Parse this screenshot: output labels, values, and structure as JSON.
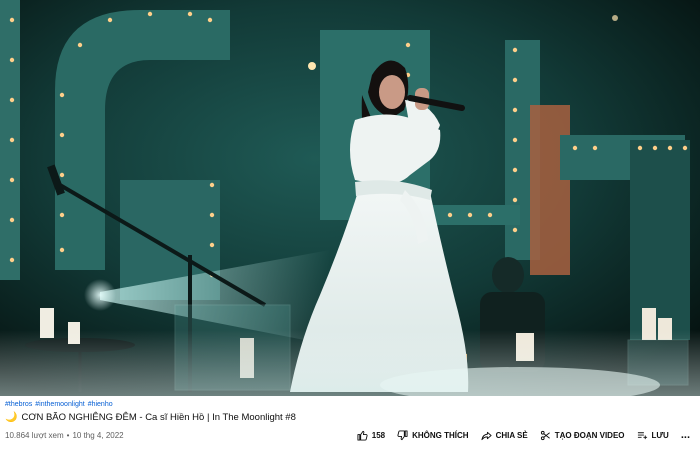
{
  "video": {
    "hashtags": [
      "#thebros",
      "#inthemoonlight",
      "#hienho"
    ],
    "title_emoji": "🌙",
    "title": "CƠN BÃO NGHIÊNG ĐÊM - Ca sĩ Hiền Hồ | In The Moonlight #8",
    "views": "10.864 lượt xem",
    "separator": "•",
    "date": "10 thg 4, 2022"
  },
  "actions": {
    "like_count": "158",
    "dislike_label": "KHÔNG THÍCH",
    "share_label": "CHIA SẺ",
    "clip_label": "TẠO ĐOẠN VIDEO",
    "save_label": "LƯU",
    "more_label": "..."
  },
  "icons": {
    "like": "thumb-up-icon",
    "dislike": "thumb-down-icon",
    "share": "share-arrow-icon",
    "clip": "scissors-icon",
    "save": "playlist-add-icon"
  },
  "colors": {
    "link": "#065fd4",
    "meta": "#606060",
    "scene_bg": "#0b1f1e"
  }
}
